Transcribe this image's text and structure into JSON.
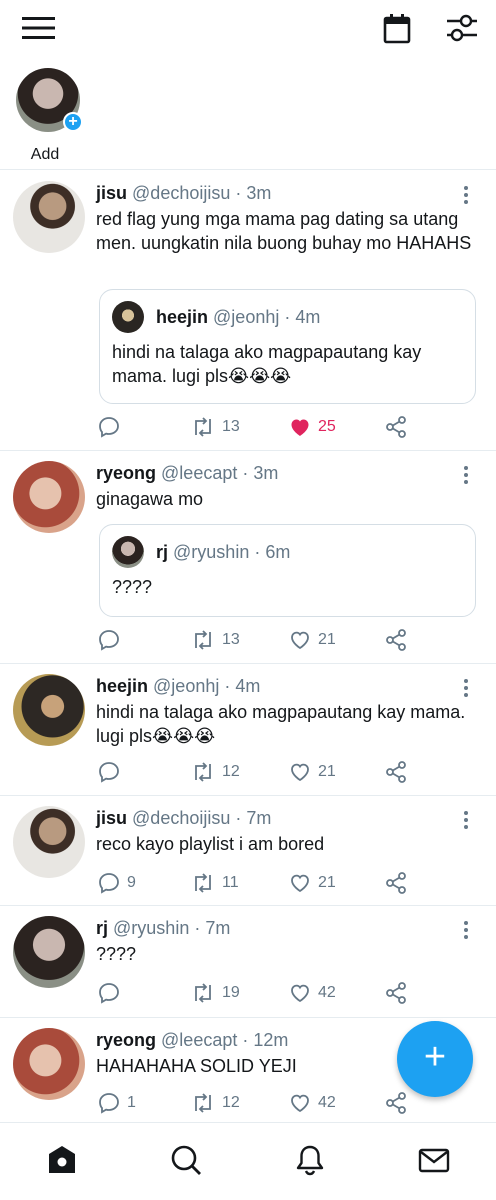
{
  "stories": {
    "add_label": "Add"
  },
  "tweets": [
    {
      "name": "jisu",
      "handle": "@dechoijisu",
      "time": "3m",
      "text": "red flag yung mga mama pag dating sa utang men. uungkatin nila buong buhay mo HAHAHS",
      "quote": {
        "name": "heejin",
        "handle": "@jeonhj",
        "time": "4m",
        "text": "hindi na talaga ako magpapautang kay mama. lugi pls😭😭😭"
      },
      "replies": "",
      "retweets": "13",
      "likes": "25",
      "liked": true
    },
    {
      "name": "ryeong",
      "handle": "@leecapt",
      "time": "3m",
      "text": "ginagawa mo",
      "quote": {
        "name": "rj",
        "handle": "@ryushin",
        "time": "6m",
        "text": "????"
      },
      "replies": "",
      "retweets": "13",
      "likes": "21",
      "liked": false
    },
    {
      "name": "heejin",
      "handle": "@jeonhj",
      "time": "4m",
      "text": "hindi na talaga ako magpapautang kay mama. lugi pls😭😭😭",
      "replies": "",
      "retweets": "12",
      "likes": "21",
      "liked": false
    },
    {
      "name": "jisu",
      "handle": "@dechoijisu",
      "time": "7m",
      "text": "reco kayo playlist i am bored",
      "replies": "9",
      "retweets": "11",
      "likes": "21",
      "liked": false
    },
    {
      "name": "rj",
      "handle": "@ryushin",
      "time": "7m",
      "text": "????",
      "replies": "",
      "retweets": "19",
      "likes": "42",
      "liked": false
    },
    {
      "name": "ryeong",
      "handle": "@leecapt",
      "time": "12m",
      "text": "HAHAHAHA SOLID YEJI",
      "replies": "1",
      "retweets": "12",
      "likes": "42",
      "liked": false
    }
  ],
  "colors": {
    "accent": "#1da1f2",
    "like": "#e0245e",
    "muted": "#657786"
  },
  "icons": {
    "menu": "hamburger-icon",
    "calendar": "calendar-icon",
    "filter": "sliders-icon",
    "home": "home-icon",
    "search": "search-icon",
    "notifications": "bell-icon",
    "messages": "mail-icon",
    "compose": "plus-icon"
  }
}
